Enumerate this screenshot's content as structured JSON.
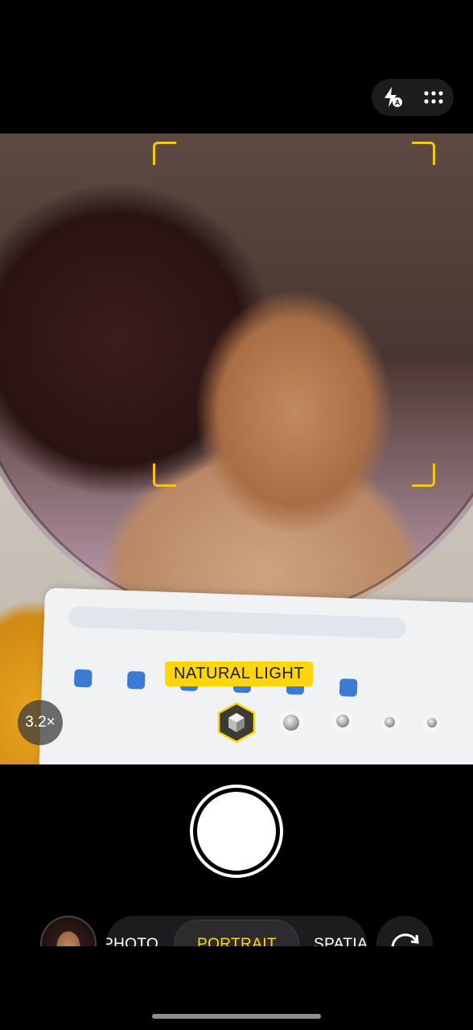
{
  "top_controls": {
    "flash_icon": "flash-auto-icon",
    "more_icon": "more-grid-icon"
  },
  "viewfinder": {
    "lighting_label": "NATURAL LIGHT",
    "zoom_label": "3.2×",
    "accent_color": "#ffd60a"
  },
  "modes": {
    "items": [
      {
        "label": "PHOTO"
      },
      {
        "label": "PORTRAIT"
      },
      {
        "label": "SPATIAL"
      }
    ],
    "active_index": 1
  },
  "icons": {
    "shutter": "shutter-icon",
    "flip": "camera-flip-icon",
    "thumbnail": "last-photo-thumbnail"
  }
}
